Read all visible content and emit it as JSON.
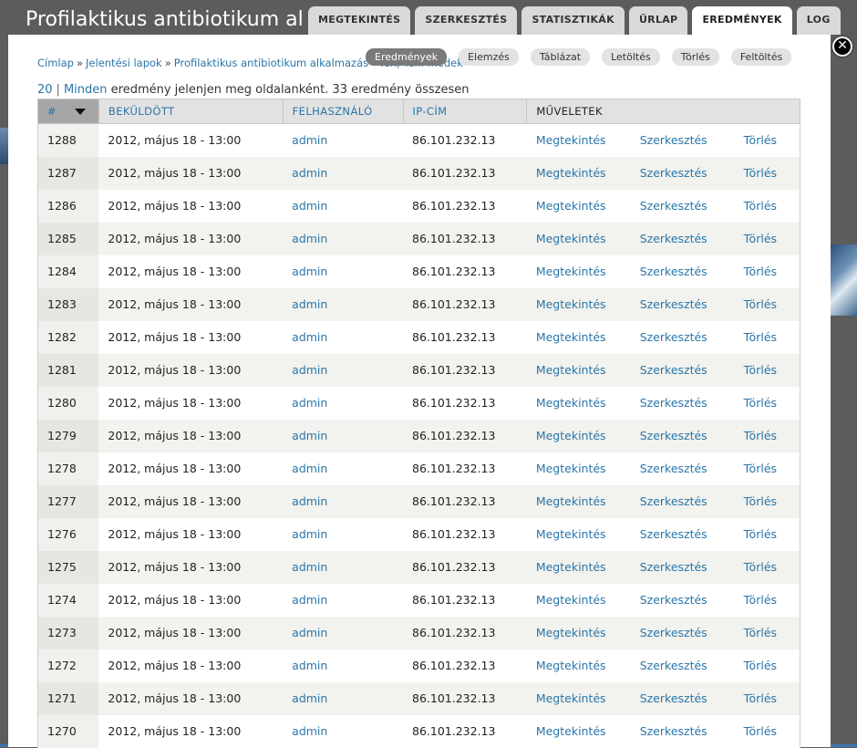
{
  "overlay": {
    "title": "Profilaktikus antibiotikum alkalmazás - Teh, Tehl médek"
  },
  "tabs": [
    {
      "label": "MEGTEKINTÉS"
    },
    {
      "label": "SZERKESZTÉS"
    },
    {
      "label": "STATISZTIKÁK"
    },
    {
      "label": "ŰRLAP"
    },
    {
      "label": "EREDMÉNYEK",
      "active": true
    },
    {
      "label": "LOG"
    }
  ],
  "close_label": "✕",
  "breadcrumb": {
    "items": [
      "Címlap",
      "Jelentési lapok",
      "Profilaktikus antibiotikum alkalmazás - Teh, Tehl médek"
    ],
    "separator": "»"
  },
  "subtabs": [
    {
      "label": "Eredmények",
      "active": true
    },
    {
      "label": "Elemzés"
    },
    {
      "label": "Táblázat"
    },
    {
      "label": "Letöltés"
    },
    {
      "label": "Törlés"
    },
    {
      "label": "Feltöltés"
    }
  ],
  "pager": {
    "per_page_option": "20",
    "separator": "|",
    "all_option": "Minden",
    "text": "eredmény jelenjen meg oldalanként. 33 eredmény összesen"
  },
  "table": {
    "headers": {
      "number": "#",
      "submitted": "BEKÜLDÖTT",
      "user": "FELHASZNÁLÓ",
      "ip": "IP-CÍM",
      "operations": "MŰVELETEK"
    },
    "rows": [
      {
        "id": "1288",
        "submitted": "2012, május 18 - 13:00",
        "user": "admin",
        "ip": "86.101.232.13",
        "view": "Megtekintés",
        "edit": "Szerkesztés",
        "delete": "Törlés"
      },
      {
        "id": "1287",
        "submitted": "2012, május 18 - 13:00",
        "user": "admin",
        "ip": "86.101.232.13",
        "view": "Megtekintés",
        "edit": "Szerkesztés",
        "delete": "Törlés"
      },
      {
        "id": "1286",
        "submitted": "2012, május 18 - 13:00",
        "user": "admin",
        "ip": "86.101.232.13",
        "view": "Megtekintés",
        "edit": "Szerkesztés",
        "delete": "Törlés"
      },
      {
        "id": "1285",
        "submitted": "2012, május 18 - 13:00",
        "user": "admin",
        "ip": "86.101.232.13",
        "view": "Megtekintés",
        "edit": "Szerkesztés",
        "delete": "Törlés"
      },
      {
        "id": "1284",
        "submitted": "2012, május 18 - 13:00",
        "user": "admin",
        "ip": "86.101.232.13",
        "view": "Megtekintés",
        "edit": "Szerkesztés",
        "delete": "Törlés"
      },
      {
        "id": "1283",
        "submitted": "2012, május 18 - 13:00",
        "user": "admin",
        "ip": "86.101.232.13",
        "view": "Megtekintés",
        "edit": "Szerkesztés",
        "delete": "Törlés"
      },
      {
        "id": "1282",
        "submitted": "2012, május 18 - 13:00",
        "user": "admin",
        "ip": "86.101.232.13",
        "view": "Megtekintés",
        "edit": "Szerkesztés",
        "delete": "Törlés"
      },
      {
        "id": "1281",
        "submitted": "2012, május 18 - 13:00",
        "user": "admin",
        "ip": "86.101.232.13",
        "view": "Megtekintés",
        "edit": "Szerkesztés",
        "delete": "Törlés"
      },
      {
        "id": "1280",
        "submitted": "2012, május 18 - 13:00",
        "user": "admin",
        "ip": "86.101.232.13",
        "view": "Megtekintés",
        "edit": "Szerkesztés",
        "delete": "Törlés"
      },
      {
        "id": "1279",
        "submitted": "2012, május 18 - 13:00",
        "user": "admin",
        "ip": "86.101.232.13",
        "view": "Megtekintés",
        "edit": "Szerkesztés",
        "delete": "Törlés"
      },
      {
        "id": "1278",
        "submitted": "2012, május 18 - 13:00",
        "user": "admin",
        "ip": "86.101.232.13",
        "view": "Megtekintés",
        "edit": "Szerkesztés",
        "delete": "Törlés"
      },
      {
        "id": "1277",
        "submitted": "2012, május 18 - 13:00",
        "user": "admin",
        "ip": "86.101.232.13",
        "view": "Megtekintés",
        "edit": "Szerkesztés",
        "delete": "Törlés"
      },
      {
        "id": "1276",
        "submitted": "2012, május 18 - 13:00",
        "user": "admin",
        "ip": "86.101.232.13",
        "view": "Megtekintés",
        "edit": "Szerkesztés",
        "delete": "Törlés"
      },
      {
        "id": "1275",
        "submitted": "2012, május 18 - 13:00",
        "user": "admin",
        "ip": "86.101.232.13",
        "view": "Megtekintés",
        "edit": "Szerkesztés",
        "delete": "Törlés"
      },
      {
        "id": "1274",
        "submitted": "2012, május 18 - 13:00",
        "user": "admin",
        "ip": "86.101.232.13",
        "view": "Megtekintés",
        "edit": "Szerkesztés",
        "delete": "Törlés"
      },
      {
        "id": "1273",
        "submitted": "2012, május 18 - 13:00",
        "user": "admin",
        "ip": "86.101.232.13",
        "view": "Megtekintés",
        "edit": "Szerkesztés",
        "delete": "Törlés"
      },
      {
        "id": "1272",
        "submitted": "2012, május 18 - 13:00",
        "user": "admin",
        "ip": "86.101.232.13",
        "view": "Megtekintés",
        "edit": "Szerkesztés",
        "delete": "Törlés"
      },
      {
        "id": "1271",
        "submitted": "2012, május 18 - 13:00",
        "user": "admin",
        "ip": "86.101.232.13",
        "view": "Megtekintés",
        "edit": "Szerkesztés",
        "delete": "Törlés"
      },
      {
        "id": "1270",
        "submitted": "2012, május 18 - 13:00",
        "user": "admin",
        "ip": "86.101.232.13",
        "view": "Megtekintés",
        "edit": "Szerkesztés",
        "delete": "Törlés"
      }
    ]
  }
}
